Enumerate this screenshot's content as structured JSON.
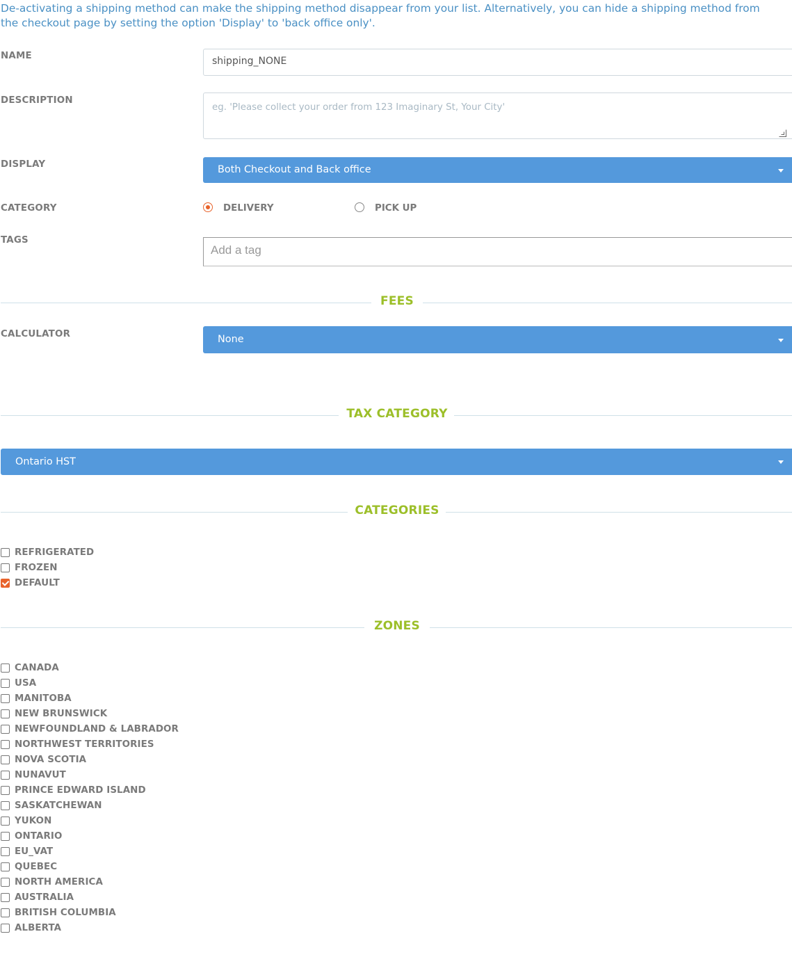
{
  "info_text": "De-activating a shipping method can make the shipping method disappear from your list. Alternatively, you can hide a shipping method from the checkout page by setting the option 'Display' to 'back office only'.",
  "form": {
    "name_label": "NAME",
    "name_value": "shipping_NONE",
    "description_label": "DESCRIPTION",
    "description_placeholder": "eg. 'Please collect your order from 123 Imaginary St, Your City'",
    "display_label": "DISPLAY",
    "display_value": "Both Checkout and Back office",
    "category_label": "CATEGORY",
    "category_options": [
      {
        "label": "DELIVERY",
        "selected": true
      },
      {
        "label": "PICK UP",
        "selected": false
      }
    ],
    "tags_label": "TAGS",
    "tags_placeholder": "Add a tag"
  },
  "fees": {
    "title": "FEES",
    "calculator_label": "CALCULATOR",
    "calculator_value": "None"
  },
  "tax_category": {
    "title": "TAX CATEGORY",
    "value": "Ontario HST"
  },
  "categories": {
    "title": "CATEGORIES",
    "items": [
      {
        "label": "REFRIGERATED",
        "checked": false
      },
      {
        "label": "FROZEN",
        "checked": false
      },
      {
        "label": "DEFAULT",
        "checked": true
      }
    ]
  },
  "zones": {
    "title": "ZONES",
    "items": [
      {
        "label": "CANADA",
        "checked": false
      },
      {
        "label": "USA",
        "checked": false
      },
      {
        "label": "MANITOBA",
        "checked": false
      },
      {
        "label": "NEW BRUNSWICK",
        "checked": false
      },
      {
        "label": "NEWFOUNDLAND & LABRADOR",
        "checked": false
      },
      {
        "label": "NORTHWEST TERRITORIES",
        "checked": false
      },
      {
        "label": "NOVA SCOTIA",
        "checked": false
      },
      {
        "label": "NUNAVUT",
        "checked": false
      },
      {
        "label": "PRINCE EDWARD ISLAND",
        "checked": false
      },
      {
        "label": "SASKATCHEWAN",
        "checked": false
      },
      {
        "label": "YUKON",
        "checked": false
      },
      {
        "label": "ONTARIO",
        "checked": false
      },
      {
        "label": "EU_VAT",
        "checked": false
      },
      {
        "label": "QUEBEC",
        "checked": false
      },
      {
        "label": "NORTH AMERICA",
        "checked": false
      },
      {
        "label": "AUSTRALIA",
        "checked": false
      },
      {
        "label": "BRITISH COLUMBIA",
        "checked": false
      },
      {
        "label": "ALBERTA",
        "checked": false
      }
    ]
  },
  "colors": {
    "link_blue": "#4a90c4",
    "select_blue": "#5499dc",
    "section_green": "#9cbf29",
    "accent_orange": "#e8632b"
  }
}
